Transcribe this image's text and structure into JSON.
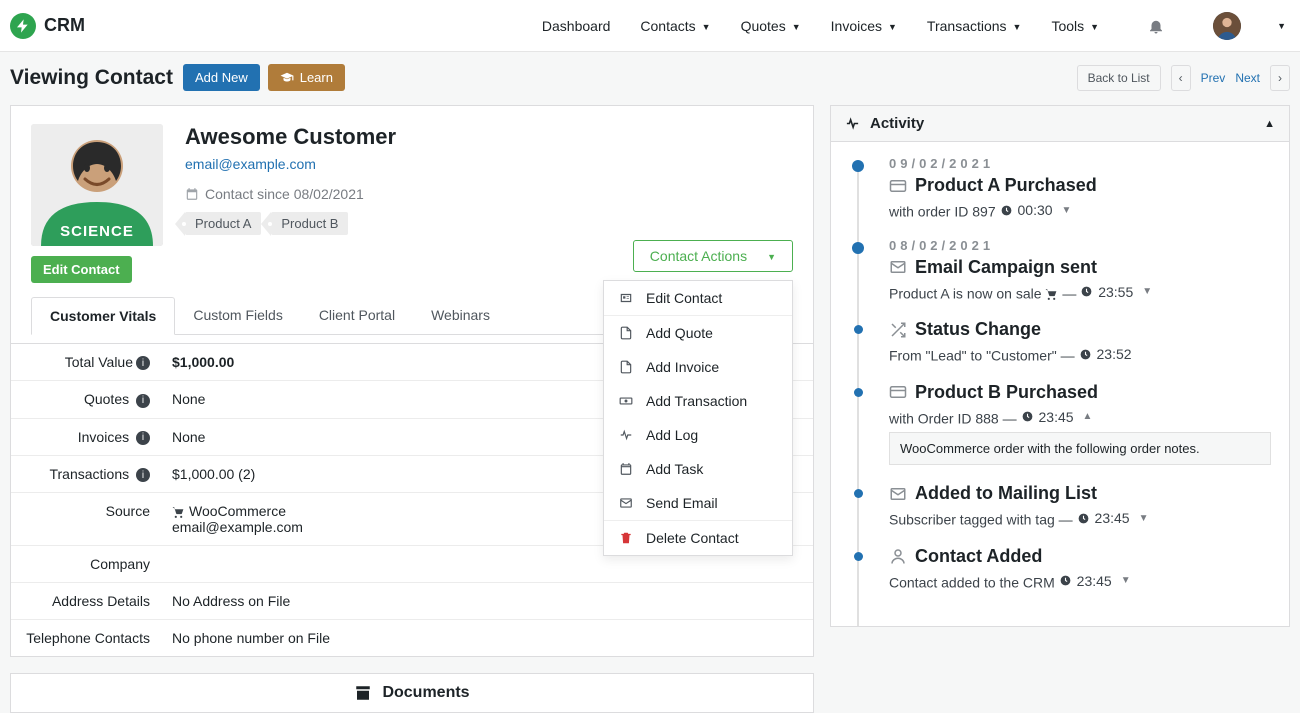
{
  "brand": {
    "name": "CRM"
  },
  "topnav": {
    "dashboard": "Dashboard",
    "contacts": "Contacts",
    "quotes": "Quotes",
    "invoices": "Invoices",
    "transactions": "Transactions",
    "tools": "Tools"
  },
  "pagehead": {
    "title": "Viewing Contact",
    "add_new": "Add New",
    "learn": "Learn",
    "back": "Back to List",
    "prev": "Prev",
    "next": "Next"
  },
  "contact": {
    "name": "Awesome Customer",
    "email": "email@example.com",
    "since_label": "Contact since 08/02/2021",
    "tag_a": "Product A",
    "tag_b": "Product B",
    "edit_btn": "Edit Contact"
  },
  "actions": {
    "button": "Contact Actions",
    "edit": "Edit Contact",
    "add_quote": "Add Quote",
    "add_invoice": "Add Invoice",
    "add_transaction": "Add Transaction",
    "add_log": "Add Log",
    "add_task": "Add Task",
    "send_email": "Send Email",
    "delete": "Delete Contact"
  },
  "tabs": {
    "vitals": "Customer Vitals",
    "custom": "Custom Fields",
    "portal": "Client Portal",
    "webinars": "Webinars"
  },
  "vitals": {
    "total_value_label": "Total Value",
    "total_value": "$1,000.00",
    "quotes_label": "Quotes",
    "quotes": "None",
    "invoices_label": "Invoices",
    "invoices": "None",
    "transactions_label": "Transactions",
    "transactions": "$1,000.00 (2)",
    "source_label": "Source",
    "source_value": "WooCommerce",
    "source_email": "email@example.com",
    "company_label": "Company",
    "address_label": "Address Details",
    "address": "No Address on File",
    "phone_label": "Telephone Contacts",
    "phone": "No phone number on File"
  },
  "docs": {
    "title": "Documents"
  },
  "activity": {
    "title": "Activity",
    "items": {
      "i0": {
        "date": "09/02/2021",
        "title": "Product A Purchased",
        "desc_prefix": "with order ID 897 ",
        "time": "00:30"
      },
      "i1": {
        "date": "08/02/2021",
        "title": "Email Campaign sent",
        "desc_prefix": "Product A is now on sale ",
        "dash": " —",
        "time": "23:55"
      },
      "i2": {
        "title": "Status Change",
        "desc_prefix": "From \"Lead\" to \"Customer\" — ",
        "time": "23:52"
      },
      "i3": {
        "title": "Product B Purchased",
        "desc_prefix": "with Order ID 888 — ",
        "time": "23:45",
        "note": "WooCommerce order with the following order notes."
      },
      "i4": {
        "title": "Added to Mailing List",
        "desc_prefix": "Subscriber tagged with tag — ",
        "time": "23:45"
      },
      "i5": {
        "title": "Contact Added",
        "desc_prefix": "Contact added to the CRM ",
        "time": "23:45"
      }
    }
  }
}
